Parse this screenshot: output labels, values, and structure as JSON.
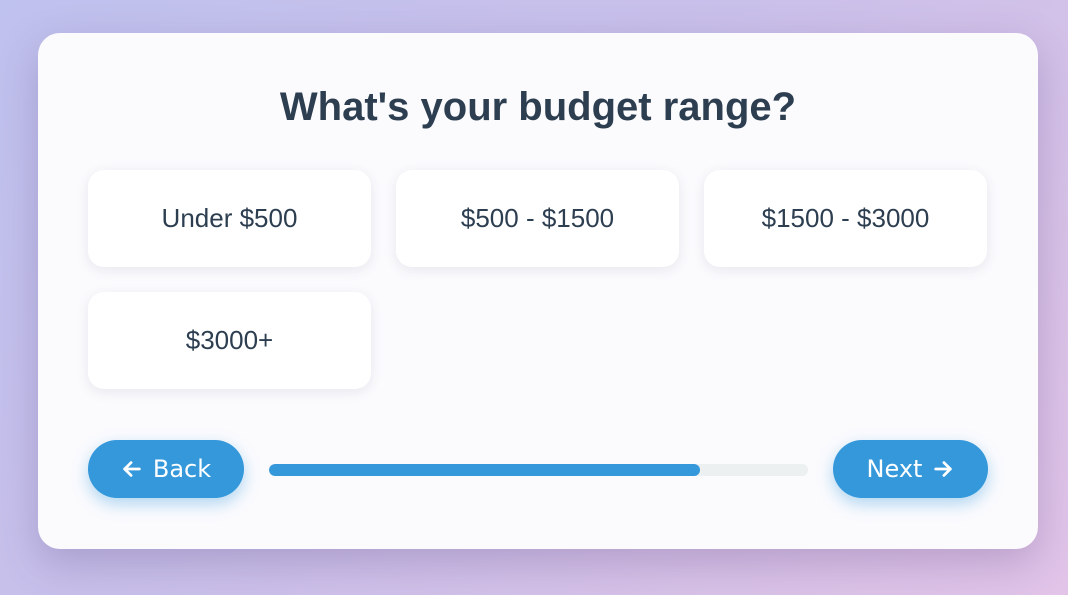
{
  "question": {
    "title": "What's your budget range?"
  },
  "options": [
    {
      "label": "Under $500"
    },
    {
      "label": "$500 - $1500"
    },
    {
      "label": "$1500 - $3000"
    },
    {
      "label": "$3000+"
    }
  ],
  "navigation": {
    "back_label": "Back",
    "back_icon": "arrow-left-icon",
    "next_label": "Next",
    "next_icon": "arrow-right-icon"
  },
  "progress": {
    "percent": 80
  },
  "colors": {
    "accent": "#3498db",
    "text": "#2c3e50",
    "track": "#ecf0f1"
  }
}
